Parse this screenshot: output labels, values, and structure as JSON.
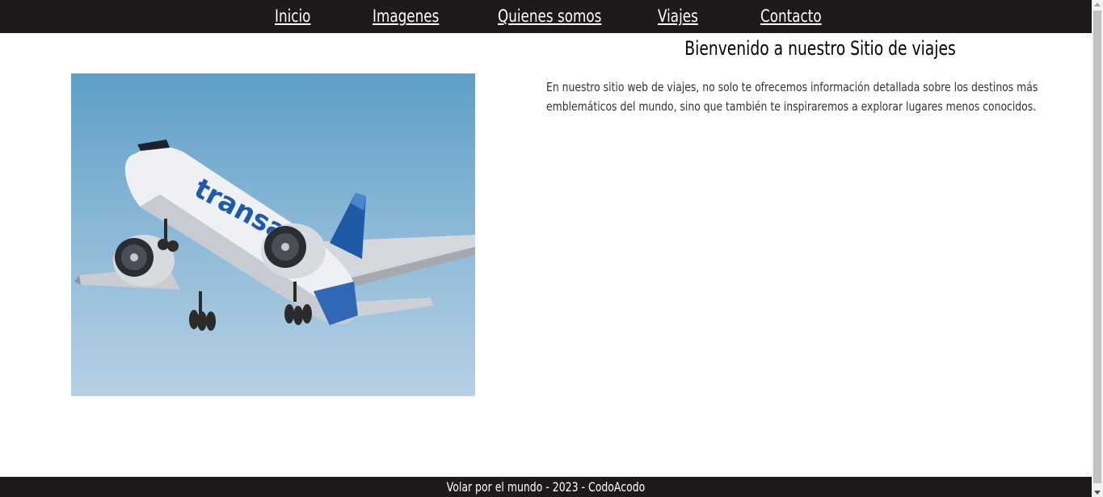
{
  "nav": {
    "items": [
      {
        "label": "Inicio"
      },
      {
        "label": "Imagenes"
      },
      {
        "label": "Quienes somos"
      },
      {
        "label": "Viajes"
      },
      {
        "label": "Contacto"
      }
    ]
  },
  "hero": {
    "image_alt": "Avión de Air Transat en vuelo",
    "airline_text": "transat"
  },
  "main": {
    "title": "Bienvenido a nuestro Sitio de viajes",
    "intro": "En nuestro sitio web de viajes, no solo te ofrecemos información detallada sobre los destinos más emblemáticos del mundo, sino que también te inspiraremos a explorar lugares menos conocidos."
  },
  "footer": {
    "text": "Volar por el mundo - 2023 - CodoAcodo"
  },
  "colors": {
    "bar_background": "#1e1a1b",
    "link_color": "#ffffff",
    "sky_top": "#5e9fc6",
    "sky_bottom": "#b7d0e5",
    "airline_blue": "#1f5aa8"
  }
}
